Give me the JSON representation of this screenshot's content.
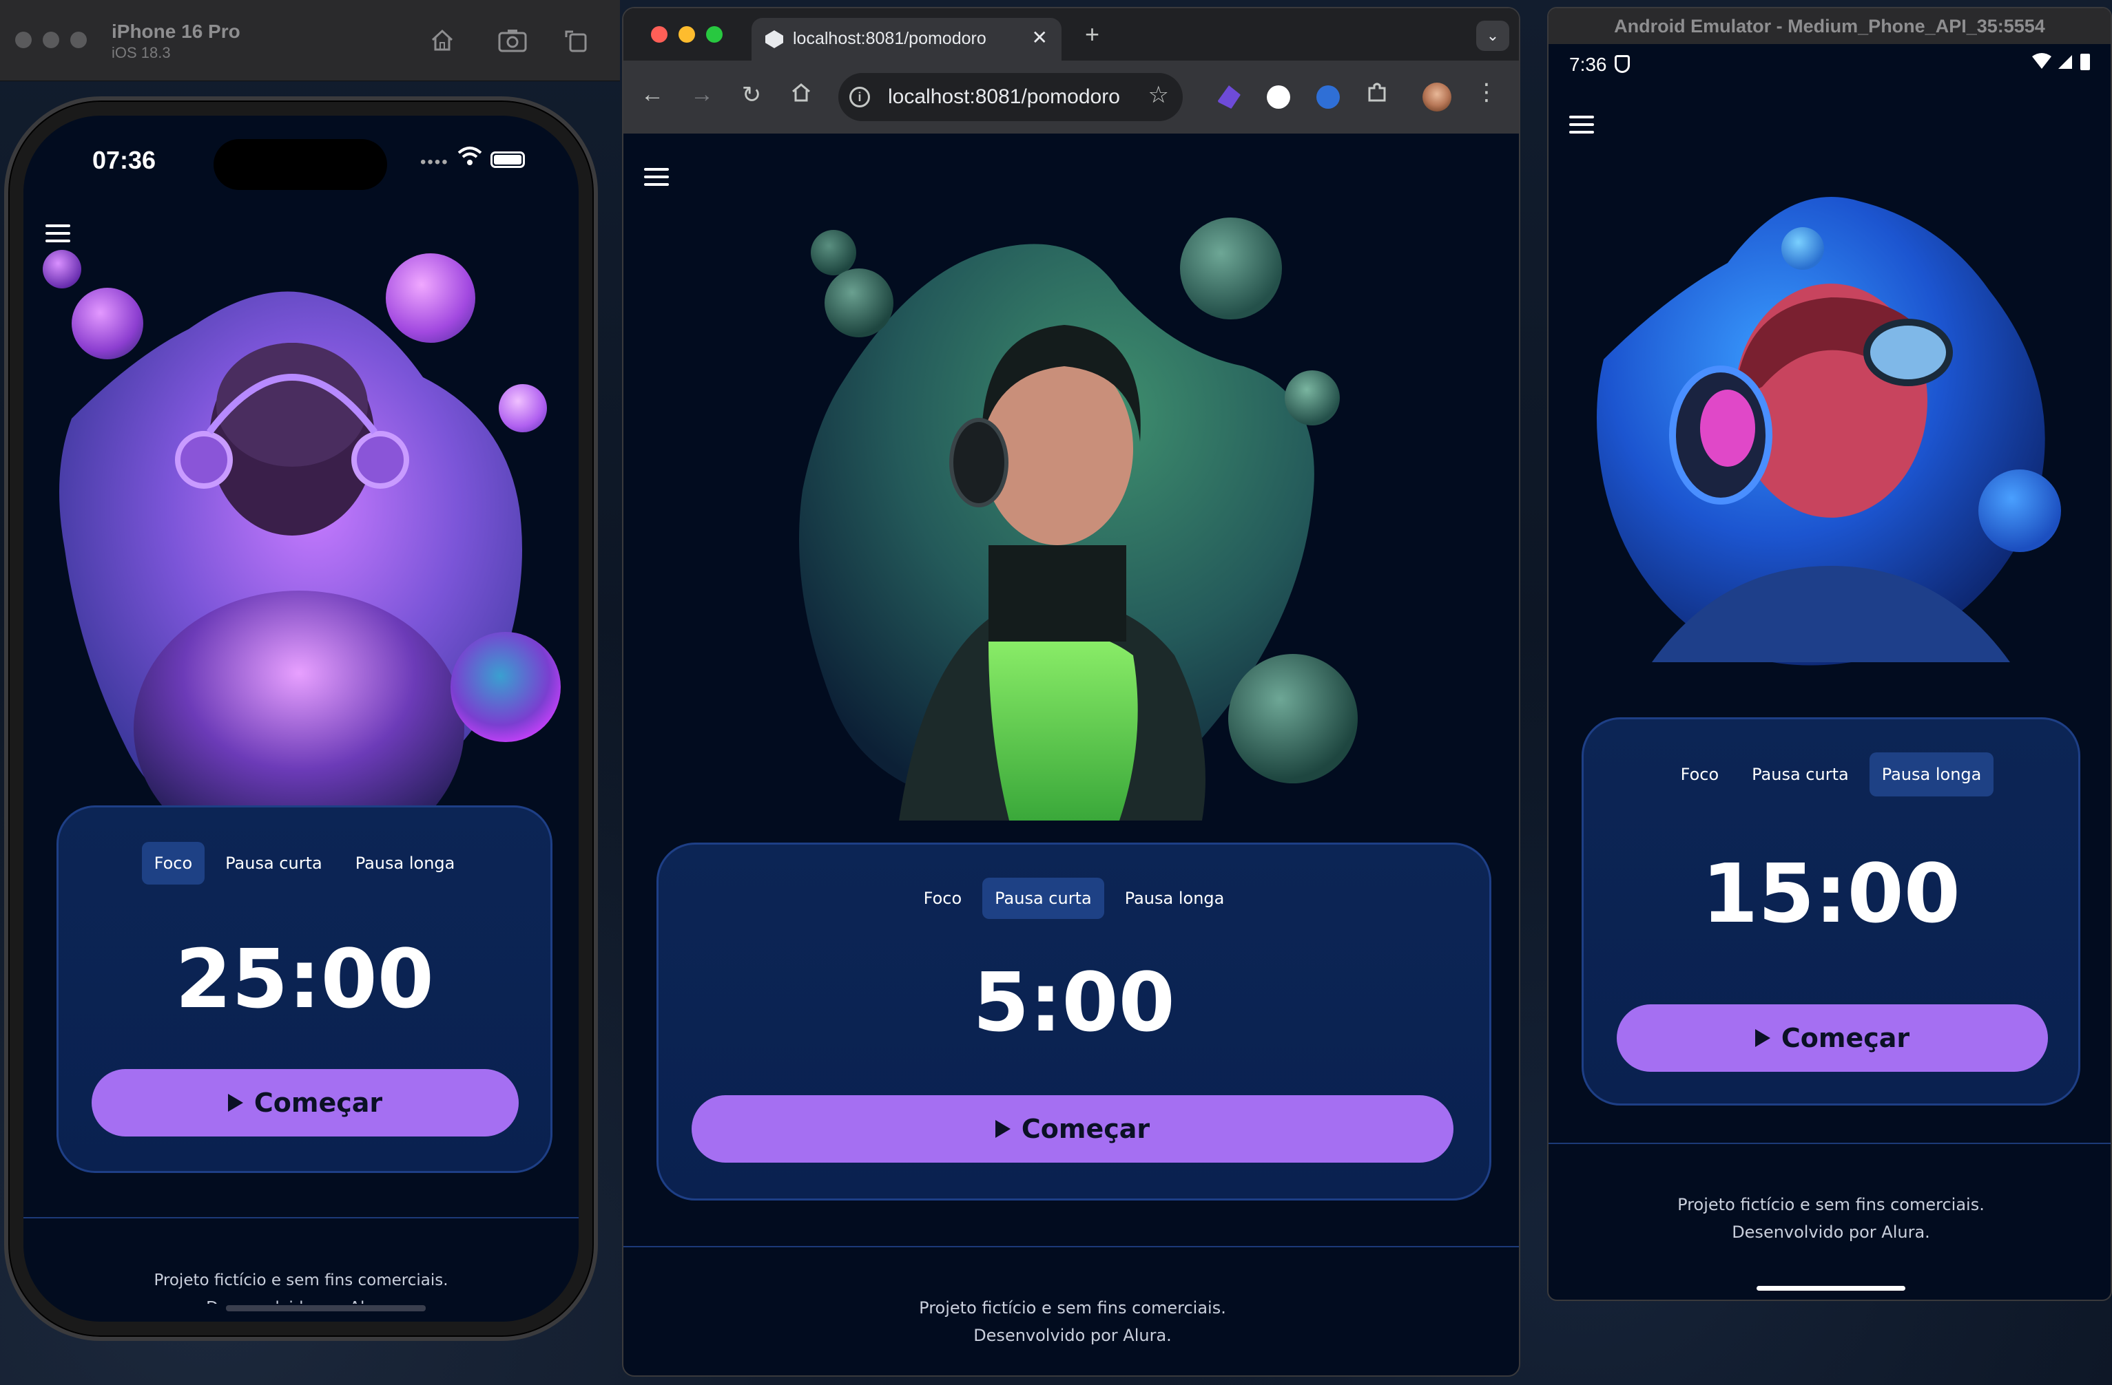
{
  "colors": {
    "app_background": "#020c1f",
    "card_background": "#0b2352",
    "card_border": "#1e3f86",
    "active_tab": "#1e4185",
    "primary_button": "#a56ff2",
    "button_text": "#0b1125"
  },
  "app": {
    "tabs": [
      "Foco",
      "Pausa curta",
      "Pausa longa"
    ],
    "start_label": "Começar",
    "footer_line1": "Projeto fictício e sem fins comerciais.",
    "footer_line2": "Desenvolvido por Alura."
  },
  "ios_simulator": {
    "device_name": "iPhone 16 Pro",
    "os_version": "iOS 18.3",
    "status_time": "07:36",
    "active_tab": "Foco",
    "timer": "25:00",
    "toolbar_icons": [
      "home-icon",
      "screenshot-icon",
      "rotate-icon"
    ]
  },
  "chrome": {
    "tab_title": "localhost:8081/pomodoro",
    "url": "localhost:8081/pomodoro",
    "active_tab": "Pausa curta",
    "timer": "5:00"
  },
  "android_emulator": {
    "window_title": "Android Emulator - Medium_Phone_API_35:5554",
    "status_time": "7:36",
    "active_tab": "Pausa longa",
    "timer": "15:00"
  }
}
